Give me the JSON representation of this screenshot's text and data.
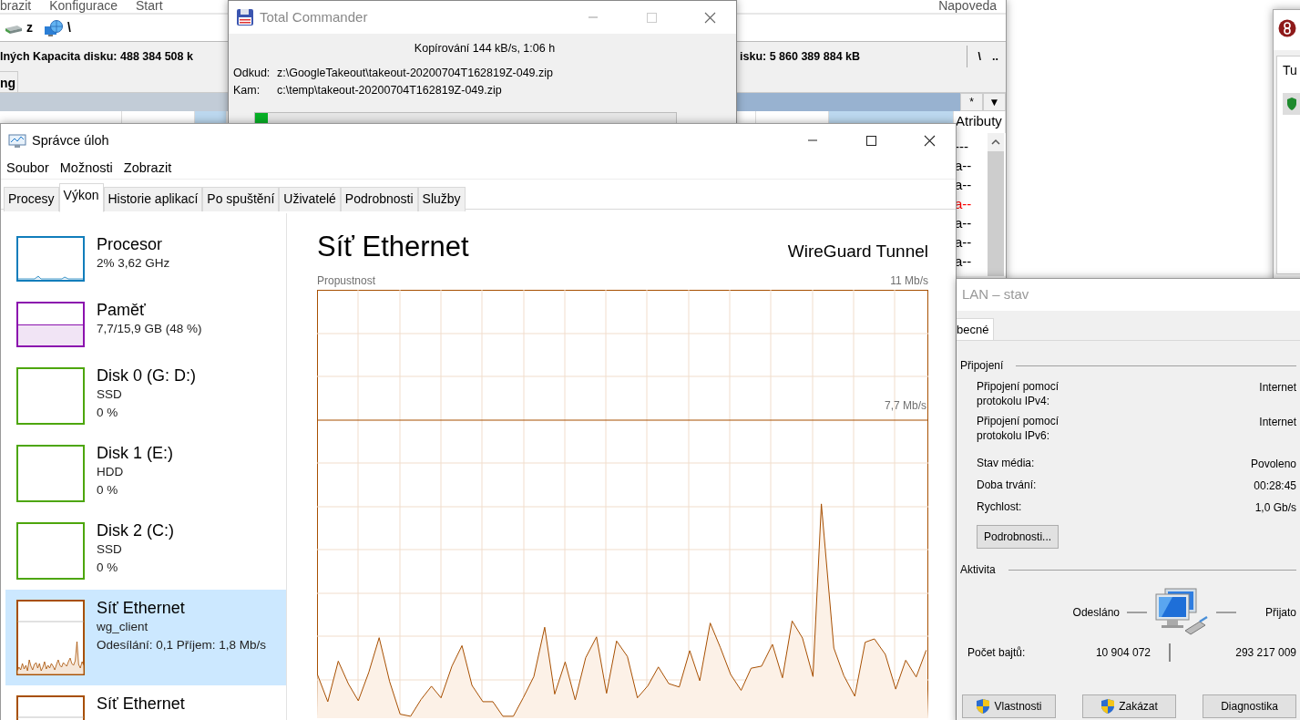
{
  "file_manager": {
    "menu": [
      "brazit",
      "Konfigurace",
      "Start",
      "Napoveda"
    ],
    "drives": [
      {
        "label": "z",
        "kind": "disk"
      },
      {
        "label": "\\",
        "kind": "network"
      }
    ],
    "left_info": "lných  Kapacita disku: 488 384 508 k",
    "right_info": "isku: 5 860 389 884 kB",
    "root_button": "\\",
    "up_button": "..",
    "left_tab": "ng",
    "filter_button": "*",
    "history_button": "▼",
    "left_columns": [
      {
        "sorted": false
      },
      {
        "sorted": false
      },
      {
        "sorted": true
      }
    ],
    "right_columns": [
      {
        "sorted": false
      },
      {
        "sorted": false
      },
      {
        "sorted": true
      },
      {
        "label": "Atributy",
        "sorted": false
      }
    ],
    "attributes": [
      {
        "text": "---",
        "color": "#000000"
      },
      {
        "text": "a--",
        "color": "#000000"
      },
      {
        "text": "a--",
        "color": "#000000"
      },
      {
        "text": "a--",
        "color": "#ff0000"
      },
      {
        "text": "a--",
        "color": "#000000"
      },
      {
        "text": "a--",
        "color": "#000000"
      },
      {
        "text": "a--",
        "color": "#000000"
      }
    ]
  },
  "copy_dialog": {
    "title": "Total Commander",
    "status": "Kopírování 144 kB/s, 1:06 h",
    "from_label": "Odkud:",
    "from": "z:\\GoogleTakeout\\takeout-20200704T162819Z-049.zip",
    "to_label": "Kam:",
    "to": "c:\\temp\\takeout-20200704T162819Z-049.zip",
    "progress": {
      "level": 0.03
    }
  },
  "side_window": {
    "tab": "Tu"
  },
  "task_manager": {
    "title": "Správce úloh",
    "menu": [
      "Soubor",
      "Možnosti",
      "Zobrazit"
    ],
    "tabs": [
      {
        "label": "Procesy",
        "selected": false
      },
      {
        "label": "Výkon",
        "selected": true
      },
      {
        "label": "Historie aplikací",
        "selected": false
      },
      {
        "label": "Po spuštění",
        "selected": false
      },
      {
        "label": "Uživatelé",
        "selected": false
      },
      {
        "label": "Podrobnosti",
        "selected": false
      },
      {
        "label": "Služby",
        "selected": false
      }
    ],
    "resources": [
      {
        "kind": "cpu",
        "name": "Procesor",
        "lines": [
          "2% 3,62 GHz"
        ],
        "color": "#117dbb",
        "selected": false
      },
      {
        "kind": "memory",
        "name": "Paměť",
        "lines": [
          "7,7/15,9 GB (48 %)"
        ],
        "color": "#8b12ae",
        "selected": false
      },
      {
        "kind": "disk",
        "name": "Disk 0 (G: D:)",
        "lines": [
          "SSD",
          "0 %"
        ],
        "color": "#4da60c",
        "selected": false
      },
      {
        "kind": "disk",
        "name": "Disk 1 (E:)",
        "lines": [
          "HDD",
          "0 %"
        ],
        "color": "#4da60c",
        "selected": false
      },
      {
        "kind": "disk",
        "name": "Disk 2 (C:)",
        "lines": [
          "SSD",
          "0 %"
        ],
        "color": "#4da60c",
        "selected": false
      },
      {
        "kind": "network",
        "name": "Síť Ethernet",
        "lines": [
          "wg_client",
          "Odesílání: 0,1 Příjem: 1,8 Mb/s"
        ],
        "color": "#a74f01",
        "selected": true
      },
      {
        "kind": "network",
        "name": "Síť Ethernet",
        "color": "#a74f01",
        "selected": false
      }
    ],
    "detail": {
      "title": "Síť Ethernet",
      "adapter": "WireGuard Tunnel",
      "graph_label": "Propustnost",
      "graph_max": "11 Mb/s",
      "graph_line": "7,7 Mb/s"
    }
  },
  "lan_status": {
    "title": "LAN – stav",
    "tabs": [
      {
        "label": "becné",
        "selected": true
      }
    ],
    "connection_heading": "Připojení",
    "properties": [
      {
        "label": "Připojení pomocí protokolu IPv4:",
        "value": "Internet"
      },
      {
        "label": "Připojení pomocí protokolu IPv6:",
        "value": "Internet"
      },
      {
        "label": "Stav média:",
        "value": "Povoleno"
      },
      {
        "label": "Doba trvání:",
        "value": "00:28:45"
      },
      {
        "label": "Rychlost:",
        "value": "1,0 Gb/s"
      }
    ],
    "details_button": "Podrobnosti...",
    "activity_heading": "Aktivita",
    "sent_label": "Odesláno",
    "received_label": "Přijato",
    "bytes_label": "Počet bajtů:",
    "bytes_sent": "10 904 072",
    "bytes_received": "293 217 009",
    "buttons": [
      {
        "label": "Vlastnosti",
        "shield": true
      },
      {
        "label": "Zakázat",
        "shield": true
      },
      {
        "label": "Diagnostika",
        "shield": false
      }
    ]
  }
}
